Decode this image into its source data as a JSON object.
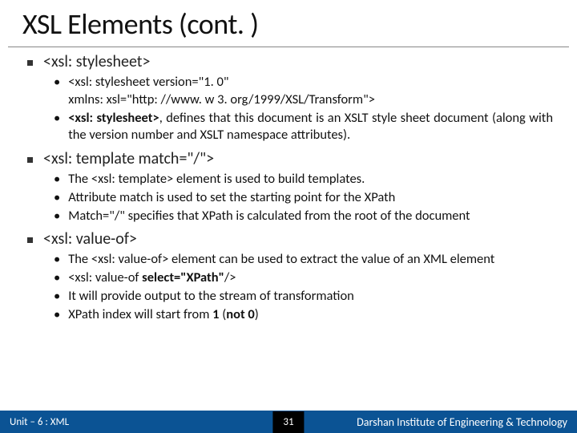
{
  "title": "XSL Elements (cont. )",
  "sections": [
    {
      "heading": "<xsl: stylesheet>",
      "items": [
        {
          "pre": "",
          "bold": "",
          "post": "<xsl: stylesheet version=\"1. 0\"\nxmlns: xsl=\"http: //www. w 3. org/1999/XSL/Transform\">"
        },
        {
          "pre": "",
          "bold": "<xsl: stylesheet>",
          "post": ", defines that this document is an XSLT style sheet document (along with the version number and XSLT namespace attributes)."
        }
      ]
    },
    {
      "heading": "<xsl: template match=\"/\">",
      "items": [
        {
          "pre": "The <xsl: template> element is used to build templates.",
          "bold": "",
          "post": ""
        },
        {
          "pre": "Attribute match is used to set the starting point  for the XPath",
          "bold": "",
          "post": ""
        },
        {
          "pre": "Match=\"/\" specifies that XPath is calculated from the root of the document",
          "bold": "",
          "post": ""
        }
      ]
    },
    {
      "heading": "<xsl: value-of>",
      "items": [
        {
          "pre": "The <xsl: value-of> element can be used to extract the value of an XML element",
          "bold": "",
          "post": ""
        },
        {
          "pre": "<xsl: value-of ",
          "bold": "select=\"XPath\"",
          "post": "/>"
        },
        {
          "pre": "It will provide output to the stream of transformation",
          "bold": "",
          "post": ""
        },
        {
          "pre": "XPath index will start from ",
          "bold": "1 ",
          "post2": "(",
          "bold2": "not 0",
          "post3": ")"
        }
      ]
    }
  ],
  "footer": {
    "unit": "Unit – 6 : XML",
    "page": "31",
    "inst": "Darshan Institute of Engineering & Technology"
  }
}
